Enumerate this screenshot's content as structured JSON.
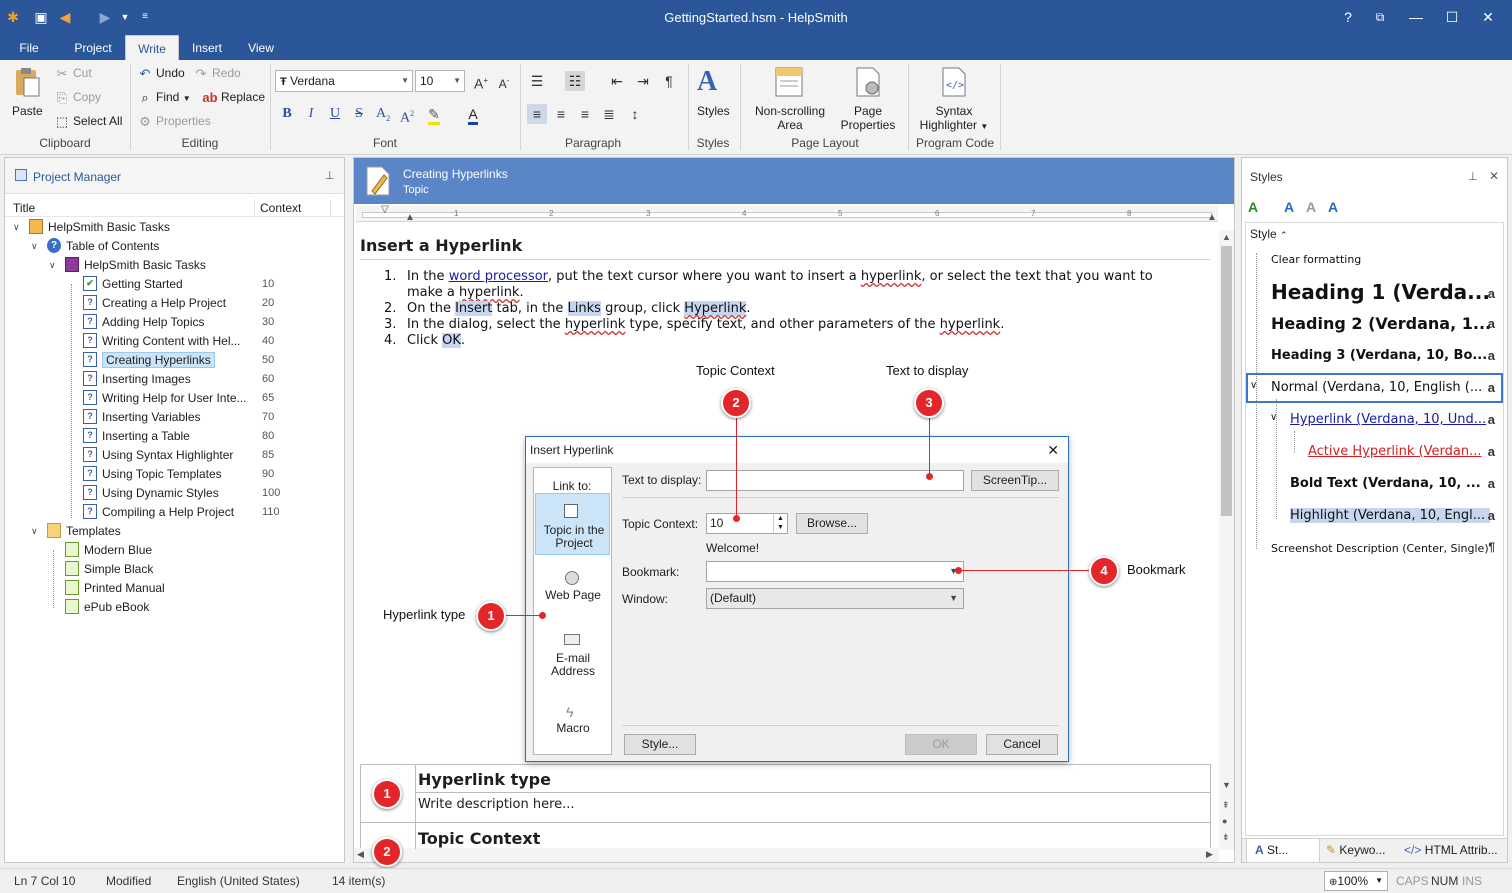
{
  "window": {
    "title": "GettingStarted.hsm - HelpSmith"
  },
  "quick_access": [
    "app-icon",
    "save-icon",
    "undo-icon",
    "redo-icon",
    "dropdown-icon",
    "customize-icon"
  ],
  "menu_tabs": [
    "File",
    "Project",
    "Write",
    "Insert",
    "View"
  ],
  "active_tab": "Write",
  "ribbon": {
    "clipboard": {
      "label": "Clipboard",
      "paste": "Paste",
      "cut": "Cut",
      "copy": "Copy",
      "select_all": "Select All"
    },
    "editing": {
      "label": "Editing",
      "undo": "Undo",
      "redo": "Redo",
      "find": "Find",
      "replace": "Replace",
      "properties": "Properties"
    },
    "font": {
      "label": "Font",
      "family": "Verdana",
      "size": "10"
    },
    "paragraph": {
      "label": "Paragraph"
    },
    "styles": {
      "label": "Styles",
      "styles_btn": "Styles"
    },
    "page_layout": {
      "label": "Page Layout",
      "non_scrolling": "Non-scrolling\nArea",
      "non_scrolling_1": "Non-scrolling",
      "non_scrolling_2": "Area",
      "page_props_1": "Page",
      "page_props_2": "Properties"
    },
    "program_code": {
      "label": "Program Code",
      "syntax_1": "Syntax",
      "syntax_2": "Highlighter"
    }
  },
  "project_manager": {
    "title": "Project Manager",
    "col_title": "Title",
    "col_context": "Context",
    "root": "HelpSmith Basic Tasks",
    "toc": "Table of Contents",
    "book": "HelpSmith Basic Tasks",
    "topics": [
      {
        "title": "Getting Started",
        "context": "10"
      },
      {
        "title": "Creating a Help Project",
        "context": "20"
      },
      {
        "title": "Adding Help Topics",
        "context": "30"
      },
      {
        "title": "Writing Content with Hel...",
        "context": "40"
      },
      {
        "title": "Creating Hyperlinks",
        "context": "50"
      },
      {
        "title": "Inserting Images",
        "context": "60"
      },
      {
        "title": "Writing Help for User Inte...",
        "context": "65"
      },
      {
        "title": "Inserting Variables",
        "context": "70"
      },
      {
        "title": "Inserting a Table",
        "context": "80"
      },
      {
        "title": "Using Syntax Highlighter",
        "context": "85"
      },
      {
        "title": "Using Topic Templates",
        "context": "90"
      },
      {
        "title": "Using Dynamic Styles",
        "context": "100"
      },
      {
        "title": "Compiling a Help Project",
        "context": "110"
      }
    ],
    "templates_folder": "Templates",
    "templates": [
      "Modern Blue",
      "Simple Black",
      "Printed Manual",
      "ePub eBook"
    ]
  },
  "editor": {
    "topic_title": "Creating Hyperlinks",
    "topic_sub": "Topic",
    "heading": "Insert a Hyperlink",
    "step1_num": "1.",
    "step1_a": "In the ",
    "step1_link": "word processor",
    "step1_b": ", put the text cursor where you want to insert a ",
    "step1_c": "hyperlink",
    "step1_d": ", or select the text that you want to",
    "step1_e": "make a ",
    "step1_f": "hyperlink",
    "step1_g": ".",
    "step2_num": "2.",
    "step2_a": "On the ",
    "step2_b": "Insert",
    "step2_c": " tab, in the ",
    "step2_d": "Links",
    "step2_e": " group, click ",
    "step2_f": "Hyperlink",
    "step2_g": ".",
    "step3_num": "3.",
    "step3_a": "In the dialog, select the ",
    "step3_b": "hyperlink",
    "step3_c": " type, specify text, and other parameters of the ",
    "step3_d": "hyperlink",
    "step3_e": ".",
    "step4_num": "4.",
    "step4_a": "Click ",
    "step4_b": "OK",
    "step4_c": ".",
    "callout_labels": {
      "topic_context": "Topic Context",
      "text_to_display": "Text to display",
      "bookmark": "Bookmark",
      "hyperlink_type": "Hyperlink type"
    },
    "callout_numbers": [
      "1",
      "2",
      "3",
      "4"
    ],
    "table_rows": [
      {
        "num": "1",
        "title": "Hyperlink type",
        "desc": "Write description here..."
      },
      {
        "num": "2",
        "title": "Topic Context"
      }
    ]
  },
  "dialog": {
    "title": "Insert Hyperlink",
    "link_to": "Link to:",
    "opt1_1": "Topic in the",
    "opt1_2": "Project",
    "opt2": "Web Page",
    "opt3_1": "E-mail",
    "opt3_2": "Address",
    "opt4": "Macro",
    "text_to_display_label": "Text to display:",
    "text_to_display_value": "",
    "screentip": "ScreenTip...",
    "topic_context_label": "Topic Context:",
    "topic_context_value": "10",
    "browse": "Browse...",
    "welcome": "Welcome!",
    "bookmark_label": "Bookmark:",
    "bookmark_value": "",
    "window_label": "Window:",
    "window_value": "(Default)",
    "style_btn": "Style...",
    "ok": "OK",
    "cancel": "Cancel"
  },
  "styles_panel": {
    "title": "Styles",
    "col": "Style",
    "items": [
      "Clear formatting",
      "Heading 1 (Verda...",
      "Heading 2 (Verdana, 1...",
      "Heading 3 (Verdana, 10, Bo...",
      "Normal (Verdana, 10, English (...",
      "Hyperlink (Verdana, 10, Und...",
      "Active Hyperlink (Verdan...",
      "Bold Text (Verdana, 10, ...",
      "Highlight (Verdana, 10, Engl...",
      "Screenshot Description (Center, Single)"
    ],
    "para_mark": "a",
    "pilcrow": "¶",
    "bottom_tabs": [
      "St...",
      "Keywo...",
      "HTML Attrib..."
    ]
  },
  "status": {
    "position": "Ln 7 Col 10",
    "state": "Modified",
    "language": "English (United States)",
    "items": "14 item(s)",
    "zoom": "100%",
    "caps": "CAPS",
    "num": "NUM",
    "ins": "INS"
  },
  "colors": {
    "accent": "#2b579a",
    "callout": "#e3262a",
    "topic_header": "#5a86c8"
  }
}
